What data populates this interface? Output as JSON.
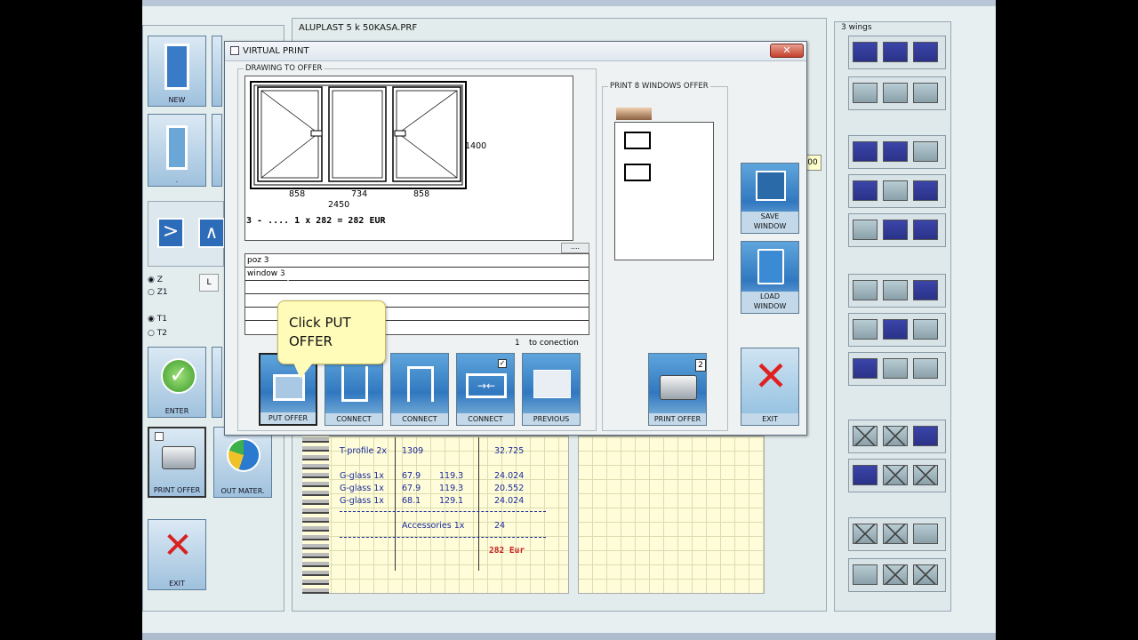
{
  "file_title": "ALUPLAST 5 k 50KASA.PRF",
  "wings_label": "3 wings",
  "left": {
    "new_label": "NEW",
    "dot_label": ".",
    "z": "Z",
    "z1": "Z1",
    "l": "L",
    "t1": "T1",
    "t2": "T2",
    "enter_label": "ENTER",
    "print_offer_label": "PRINT OFFER",
    "out_mater_label": "OUT MATER.",
    "exit_label": "EXIT"
  },
  "dialog": {
    "title": "VIRTUAL PRINT",
    "close_glyph": "✕",
    "drawing_group": "DRAWING TO OFFER",
    "dims": {
      "height": "1400",
      "w1": "858",
      "w2": "734",
      "w3": "858",
      "total": "2450"
    },
    "price_line": "3 - .... 1 x 282 = 282 EUR",
    "ellipsis": "....",
    "notes": [
      "poz 3",
      "window 3",
      "",
      "",
      "",
      ""
    ],
    "connection_count": "1",
    "connection_label": "to conection",
    "tools": [
      "PUT OFFER",
      "CONNECT",
      "CONNECT",
      "CONNECT",
      "PREVIOUS"
    ],
    "print8_group": "PRINT 8 WINDOWS OFFER",
    "print_offer_label": "PRINT OFFER",
    "print_badge": "2",
    "save_label": "SAVE\nWINDOW",
    "load_label": "LOAD\nWINDOW",
    "exit_label": "EXIT"
  },
  "tooltip": "Click PUT\nOFFER",
  "mini_value": "00",
  "notebook": {
    "rows": [
      {
        "a": "T-profile 2x",
        "b": "1309",
        "c": "",
        "d": "32.725"
      },
      {
        "a": "G-glass  1x",
        "b": "67.9",
        "c": "119.3",
        "d": "24.024"
      },
      {
        "a": "G-glass  1x",
        "b": "67.9",
        "c": "119.3",
        "d": "20.552"
      },
      {
        "a": "G-glass  1x",
        "b": "68.1",
        "c": "129.1",
        "d": "24.024"
      }
    ],
    "accessories": "Accessories   1x",
    "accessories_value": "24",
    "total": "282 Eur"
  }
}
